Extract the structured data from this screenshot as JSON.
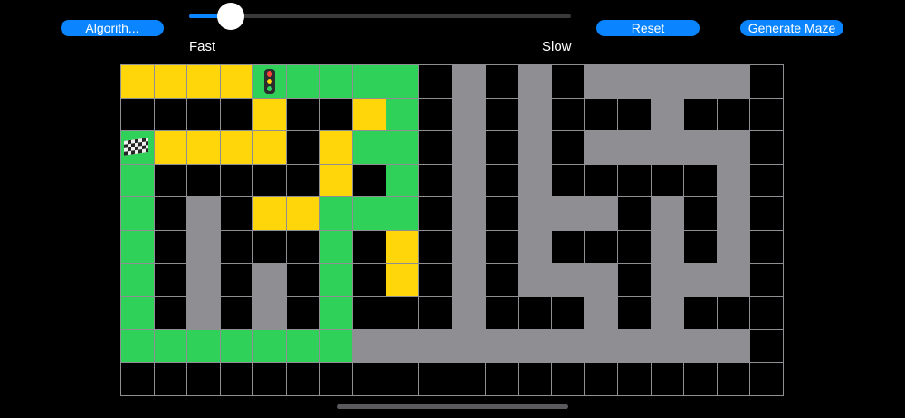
{
  "controls": {
    "algorithm_label": "Algorith...",
    "reset_label": "Reset",
    "generate_label": "Generate Maze",
    "speed_slider": {
      "value": 0.085,
      "min_label": "Fast",
      "max_label": "Slow"
    }
  },
  "colors": {
    "accent": "#0a84ff",
    "wall": "#8e8e93",
    "visited": "#30d158",
    "path": "#ffd60a",
    "empty": "#000000"
  },
  "grid": {
    "cols": 20,
    "rows": 10,
    "start_icon": "traffic-light-icon",
    "goal_icon": "checkered-flag-icon",
    "start": [
      0,
      4
    ],
    "goal": [
      2,
      0
    ],
    "cells": [
      "PPPPSVVVV.W.W.WWWWW.",
      "....P..PV.W.W...W...",
      "GPPPP.PVV.W.W.WWWWW.",
      "V.....P.V.W.W.....W.",
      "V.W.PPVVV.W.WWW.W.W.",
      "V.W...V.P.W.W...W.W.",
      "V.W.W.V.P.W.WWW.WWW.",
      "V.W.W.V...W...W.W...",
      "VVVVVVVWWWWWWWWWWWW.",
      "...................."
    ]
  }
}
